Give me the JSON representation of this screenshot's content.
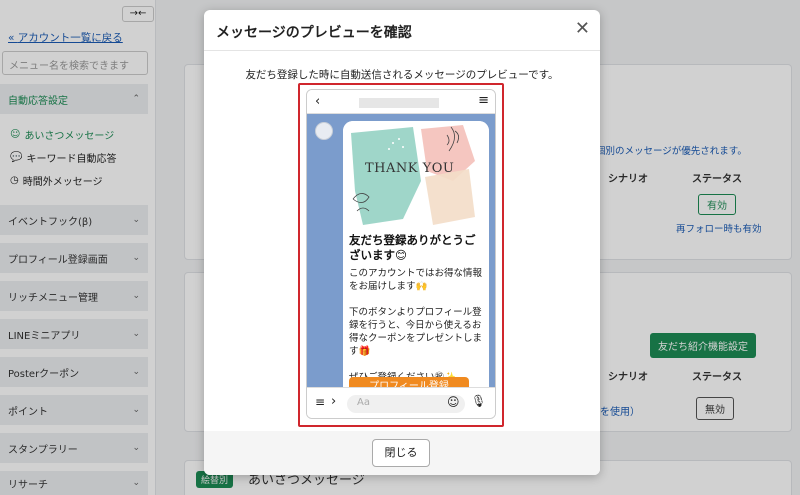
{
  "sidebar": {
    "collapse_icon": "→←",
    "back_link": "アカウント一覧に戻る",
    "search_placeholder": "メニュー名を検索できます",
    "section_auto": "自動応答設定",
    "sub_items": [
      "あいさつメッセージ",
      "キーワード自動応答",
      "時間外メッセージ"
    ],
    "sections": [
      "イベントフック(β)",
      "プロフィール登録画面",
      "リッチメニュー管理",
      "LINEミニアプリ",
      "Posterクーポン",
      "ポイント",
      "スタンプラリー",
      "リサーチ"
    ]
  },
  "background": {
    "notice_right": "個別のメッセージが優先されます。",
    "col_scenario": "シナリオ",
    "col_status": "ステータス",
    "status_active": "有効",
    "refollow_link": "再フォロー時も有効",
    "refer_button": "友だち紹介機能設定",
    "col_scenario2": "シナリオ",
    "col_status2": "ステータス",
    "use_link": "を使用）",
    "status_inactive": "無効",
    "bottom_badge": "絵替別",
    "bottom_title": "あいさつメッセージ"
  },
  "modal": {
    "title": "メッセージのプレビューを確認",
    "description": "友だち登録した時に自動送信されるメッセージのプレビューです。",
    "close_button": "閉じる",
    "phone": {
      "hero_text": "THANK YOU",
      "bubble_title": "友だち登録ありがとうございます😊",
      "bubble_body": "このアカウントではお得な情報をお届けします🙌\n\n下のボタンよりプロフィール登録を行うと、今日から使えるお得なクーポンをプレゼントします🎁\n\nぜひご登録ください㊗✨",
      "cta_button": "プロフィール登録",
      "input_placeholder": "Aa"
    }
  },
  "colors": {
    "accent_green": "#1d8c55",
    "cta_orange": "#f08a20",
    "chat_bg": "#7b9ccc",
    "highlight_red": "#d0262d"
  }
}
